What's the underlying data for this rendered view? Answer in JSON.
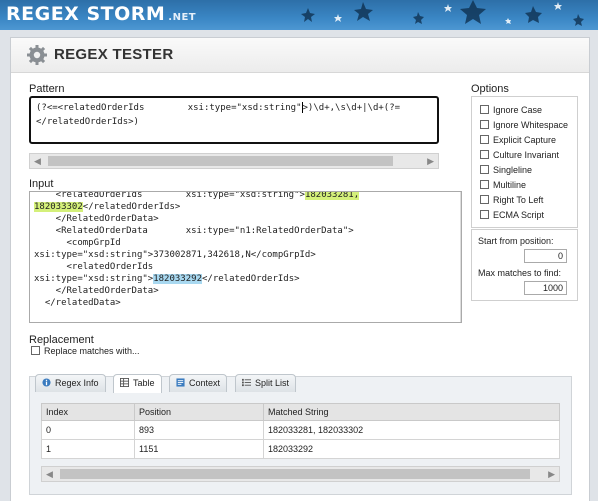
{
  "site": {
    "logo": "REGEX STORM",
    "logo_suffix": ".NET"
  },
  "header": {
    "title": "REGEX TESTER"
  },
  "pattern": {
    "label": "Pattern",
    "line1_before_cursor": "(?<=<relatedOrderIds        xsi:type=\"xsd:string\"",
    "line1_after_cursor": ">)\\d+,\\s\\d+|\\d+(?=",
    "line2": "</relatedOrderIds>)"
  },
  "input": {
    "label": "Input",
    "lines": [
      "    <relatedOrderIds        xsi:type=\"xsd:string\">",
      "182033302",
      "</relatedOrderIds>",
      "    </RelatedOrderData>",
      "    <RelatedOrderData       xsi:type=\"n1:RelatedOrderData\">",
      "      <compGrpId",
      "xsi:type=\"xsd:string\">373002871,342618,N</compGrpId>",
      "      <relatedOrderIds",
      "xsi:type=\"xsd:string\">",
      "182033292",
      "</relatedOrderIds>",
      "    </RelatedOrderData>",
      "  </relatedData>"
    ],
    "match1_part1": "182033281,"
  },
  "options": {
    "label": "Options",
    "items": [
      "Ignore Case",
      "Ignore Whitespace",
      "Explicit Capture",
      "Culture Invariant",
      "Singleline",
      "Multiline",
      "Right To Left",
      "ECMA Script"
    ],
    "start_label": "Start from position:",
    "start_value": "0",
    "max_label": "Max matches to find:",
    "max_value": "1000"
  },
  "replacement": {
    "label": "Replacement",
    "checkbox_label": "Replace matches with..."
  },
  "tabs": [
    "Regex Info",
    "Table",
    "Context",
    "Split List"
  ],
  "results": {
    "columns": [
      "Index",
      "Position",
      "Matched String"
    ],
    "rows": [
      [
        "0",
        "893",
        "182033281, 182033302"
      ],
      [
        "1",
        "1151",
        "182033292"
      ]
    ]
  },
  "colors": {
    "banner": "#3a86c4",
    "match_green": "#d4f07a",
    "match_blue": "#a8d8f0"
  },
  "icons": [
    "gear-icon",
    "info-icon",
    "table-icon",
    "context-icon",
    "list-icon",
    "star-decoration"
  ]
}
